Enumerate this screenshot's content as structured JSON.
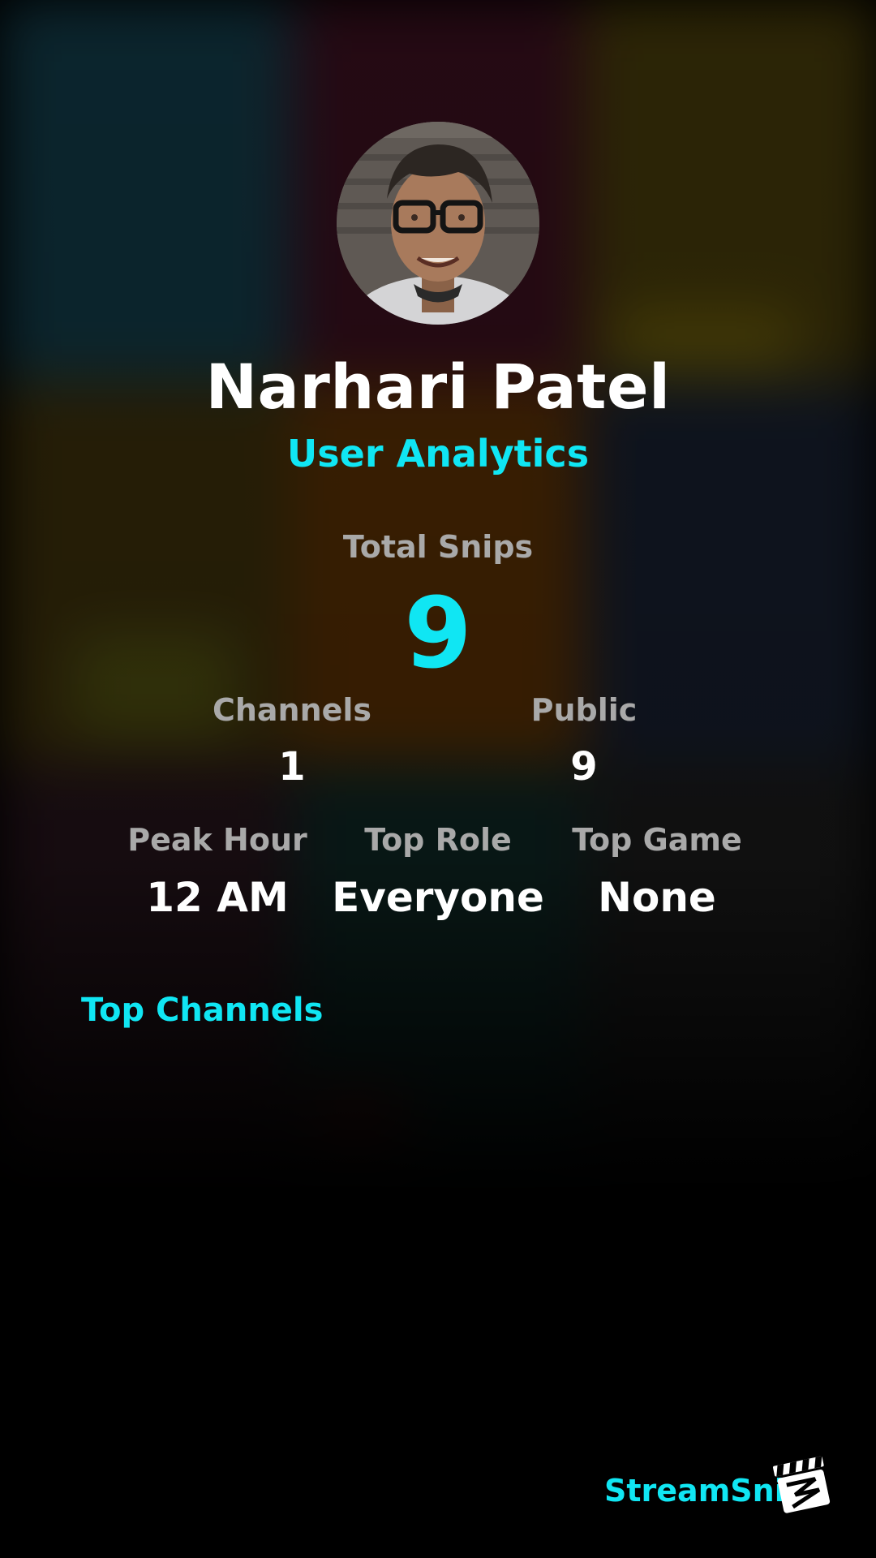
{
  "profile": {
    "name": "Narhari Patel",
    "subtitle": "User Analytics"
  },
  "stats": {
    "total_snips": {
      "label": "Total Snips",
      "value": "9"
    },
    "channels": {
      "label": "Channels",
      "value": "1"
    },
    "public": {
      "label": "Public",
      "value": "9"
    },
    "peak_hour": {
      "label": "Peak Hour",
      "value": "12 AM"
    },
    "top_role": {
      "label": "Top Role",
      "value": "Everyone"
    },
    "top_game": {
      "label": "Top Game",
      "value": "None"
    }
  },
  "sections": {
    "top_channels_title": "Top Channels"
  },
  "footer": {
    "brand": "StreamSnip",
    "logo_icon": "clapperboard-icon"
  },
  "colors": {
    "accent": "#10e6f3",
    "label_gray": "#a9a9a9",
    "background": "#000000"
  }
}
